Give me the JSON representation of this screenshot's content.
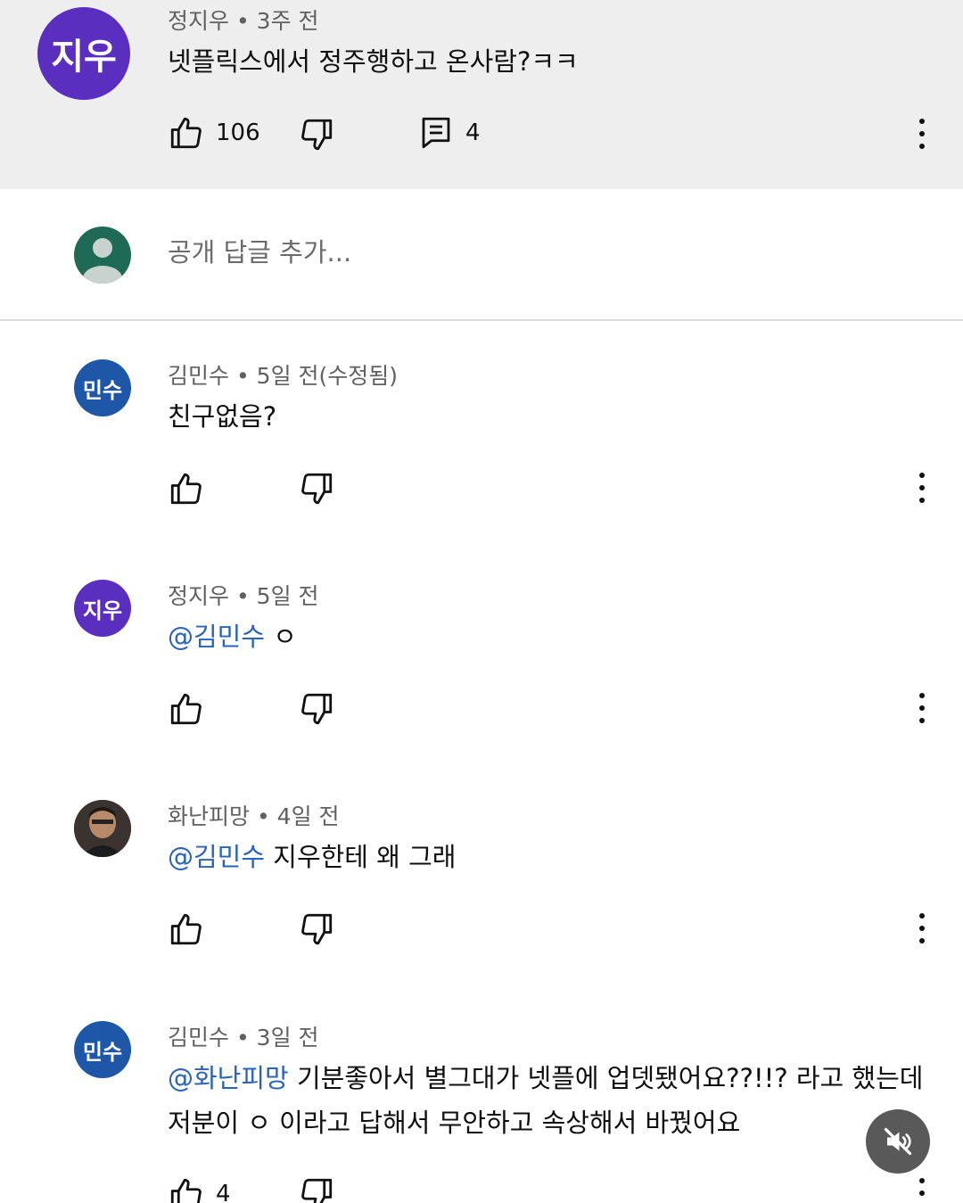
{
  "top_comment": {
    "avatar_text": "지우",
    "avatar_color": "#5a2fbf",
    "author": "정지우",
    "time": "3주 전",
    "text": "넷플릭스에서 정주행하고 온사람?ㅋㅋ",
    "likes": "106",
    "replies": "4"
  },
  "reply_box": {
    "placeholder": "공개 답글 추가..."
  },
  "replies": [
    {
      "avatar_text": "민수",
      "avatar_color": "#1f57a8",
      "author": "김민수",
      "time": "5일 전(수정됨)",
      "text": "친구없음?"
    },
    {
      "avatar_text": "지우",
      "avatar_color": "#5a2fbf",
      "author": "정지우",
      "time": "5일 전",
      "mention": "@김민수",
      "text": " ㅇ"
    },
    {
      "author": "화난피망",
      "time": "4일 전",
      "mention": "@김민수",
      "text": " 지우한테 왜 그래"
    },
    {
      "avatar_text": "민수",
      "avatar_color": "#1f57a8",
      "author": "김민수",
      "time": "3일 전",
      "mention": "@화난피망",
      "text_line1": " 기분좋아서 별그대가 넷플에 업뎃됐어요??!!? 라고 했는데",
      "text_line2": "저분이 ㅇ 이라고 답해서 무안하고 속상해서 바꿨어요",
      "likes": "4"
    }
  ],
  "separator": "•",
  "icons": [
    "thumb-up-icon",
    "thumb-down-icon",
    "reply-icon",
    "more-vert-icon",
    "mute-icon",
    "person-icon"
  ]
}
